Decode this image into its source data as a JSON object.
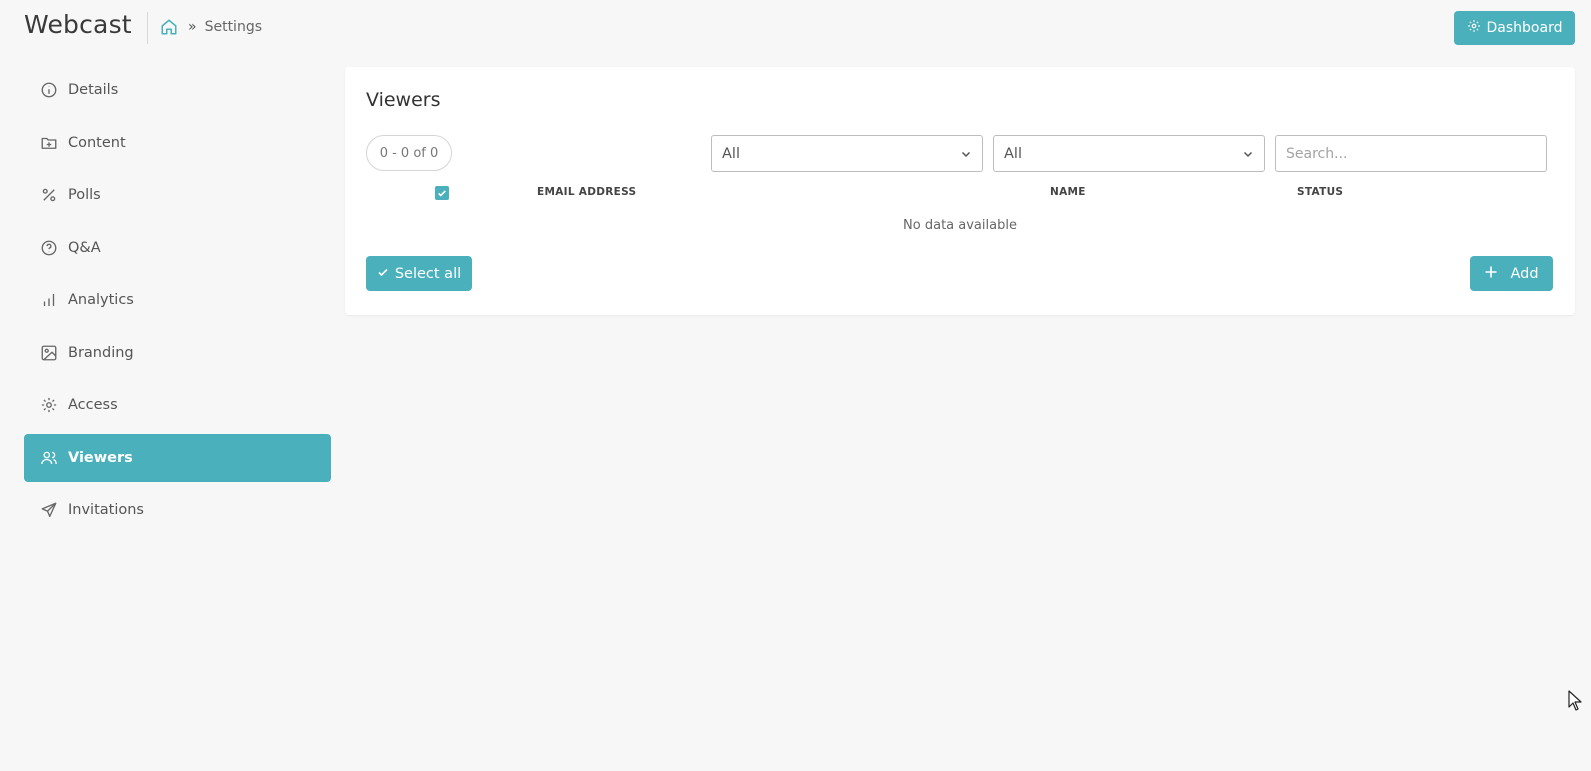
{
  "app": {
    "title": "Webcast",
    "breadcrumb": {
      "home_icon": "home-icon",
      "separator": "»",
      "current": "Settings"
    },
    "dashboard_button": {
      "icon": "gear-icon",
      "label": "Dashboard"
    }
  },
  "sidebar": {
    "items": [
      {
        "label": "Details",
        "icon": "info-icon",
        "active": false
      },
      {
        "label": "Content",
        "icon": "folder-plus-icon",
        "active": false
      },
      {
        "label": "Polls",
        "icon": "percent-icon",
        "active": false
      },
      {
        "label": "Q&A",
        "icon": "question-icon",
        "active": false
      },
      {
        "label": "Analytics",
        "icon": "bar-chart-icon",
        "active": false
      },
      {
        "label": "Branding",
        "icon": "image-icon",
        "active": false
      },
      {
        "label": "Access",
        "icon": "gear-icon",
        "active": false
      },
      {
        "label": "Viewers",
        "icon": "users-icon",
        "active": true
      },
      {
        "label": "Invitations",
        "icon": "send-icon",
        "active": false
      }
    ]
  },
  "viewers": {
    "title": "Viewers",
    "range": "0 - 0 of 0",
    "filter1": "All",
    "filter2": "All",
    "search_placeholder": "Search...",
    "columns": {
      "email": "EMAIL ADDRESS",
      "name": "NAME",
      "status": "STATUS"
    },
    "empty_text": "No data available",
    "select_all_label": "Select all",
    "add_label": "Add"
  },
  "colors": {
    "accent": "#4ab0bb",
    "background": "#f7f7f7",
    "card": "#ffffff"
  }
}
